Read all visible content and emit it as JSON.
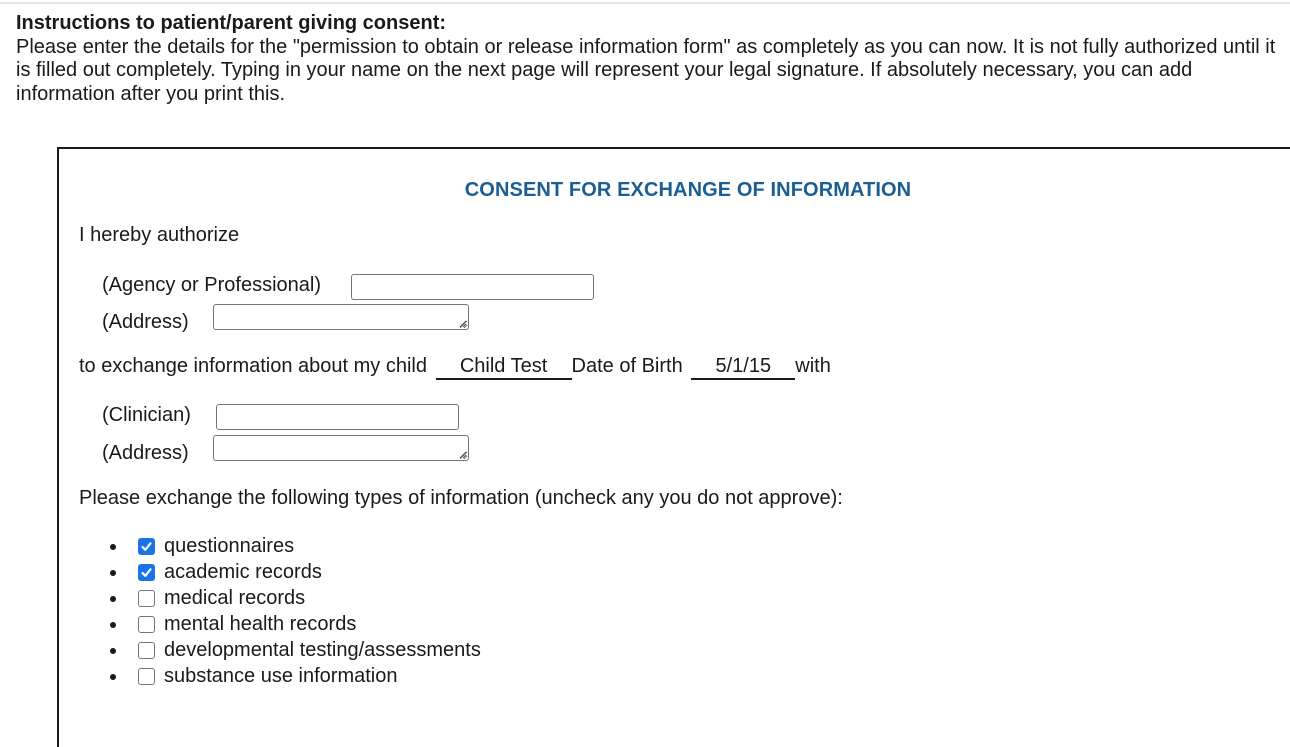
{
  "instructions": {
    "heading": "Instructions to patient/parent giving consent:",
    "body": "Please enter the details for the \"permission to obtain or release information form\" as completely as you can now. It is not fully authorized until it is filled out completely. Typing in your name on the next page will represent your legal signature. If absolutely necessary, you can add information after you print this."
  },
  "form": {
    "title": "CONSENT FOR EXCHANGE OF INFORMATION",
    "title_color": "#1a5e93",
    "authorize_text": "I hereby authorize",
    "agency_label": "(Agency or Professional)",
    "agency_value": "",
    "agency_address_label": "(Address)",
    "agency_address_value": "",
    "exchange_prefix": "to exchange information about my child",
    "child_name": "Child Test",
    "dob_label": "Date of Birth",
    "dob_value": "5/1/15",
    "exchange_suffix": "with",
    "clinician_label": "(Clinician)",
    "clinician_value": "",
    "clinician_address_label": "(Address)",
    "clinician_address_value": "",
    "types_prompt": "Please exchange the following types of information (uncheck any you do not approve):",
    "checkbox_color": "#1a73e8",
    "types": [
      {
        "label": "questionnaires",
        "checked": true
      },
      {
        "label": "academic records",
        "checked": true
      },
      {
        "label": "medical records",
        "checked": false
      },
      {
        "label": "mental health records",
        "checked": false
      },
      {
        "label": "developmental testing/assessments",
        "checked": false
      },
      {
        "label": "substance use information",
        "checked": false
      }
    ]
  }
}
